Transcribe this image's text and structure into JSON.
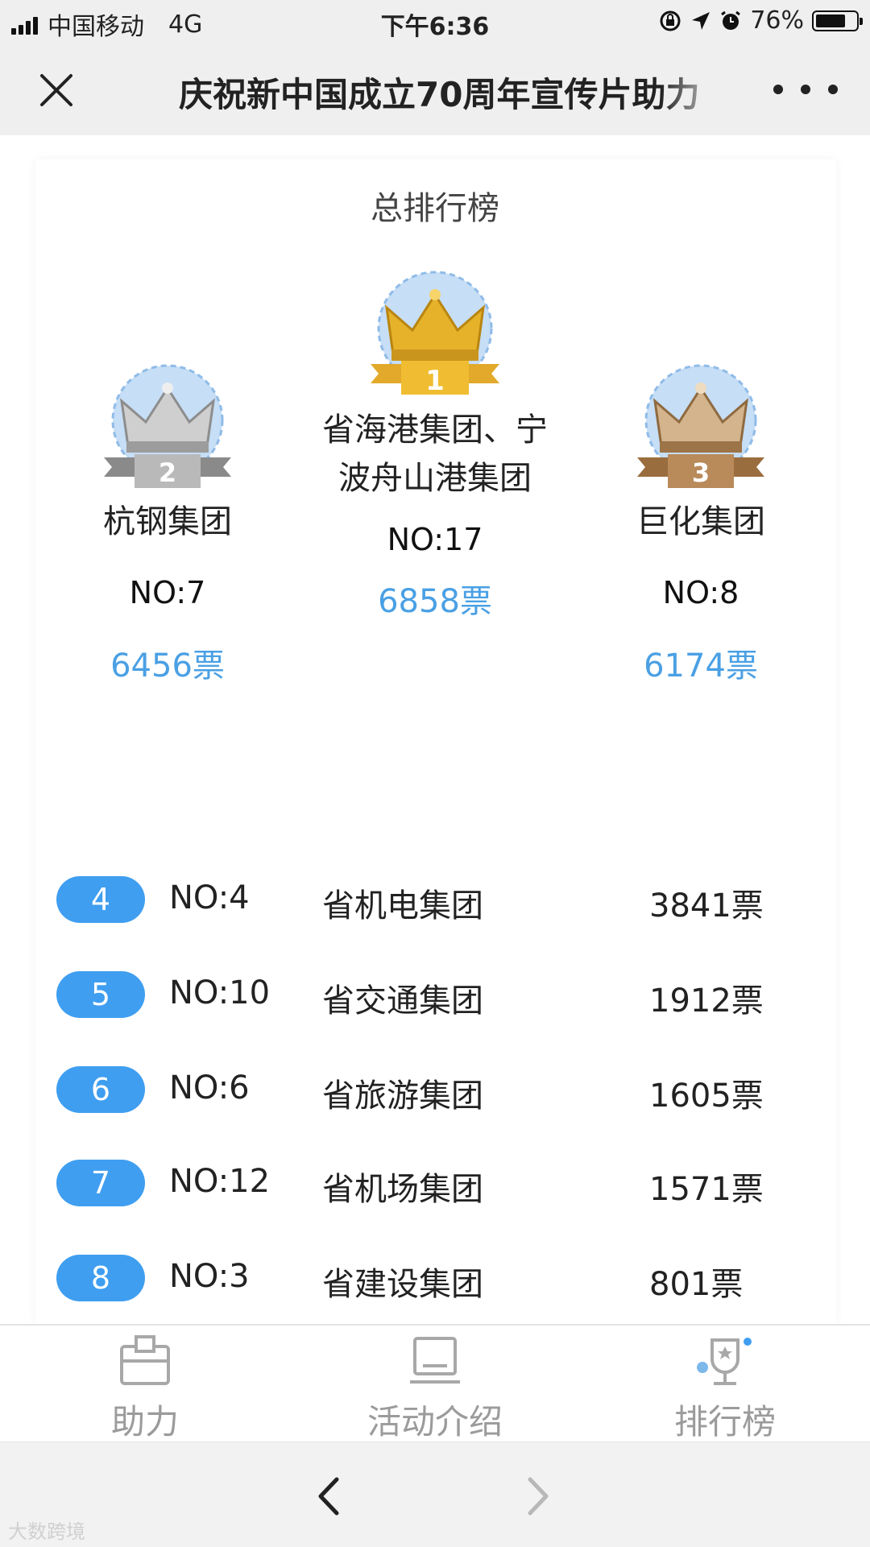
{
  "status_bar": {
    "carrier": "中国移动",
    "network": "4G",
    "time": "下午6:36",
    "battery_percent": "76%",
    "battery_level": 0.76
  },
  "title_bar": {
    "title": "庆祝新中国成立70周年宣传片助力"
  },
  "leaderboard": {
    "title": "总排行榜",
    "first": {
      "rank": "1",
      "name_line1": "省海港集团、宁",
      "name_line2": "波舟山港集团",
      "no": "NO:17",
      "votes": "6858票"
    },
    "second": {
      "rank": "2",
      "name": "杭钢集团",
      "no": "NO:7",
      "votes": "6456票"
    },
    "third": {
      "rank": "3",
      "name": "巨化集团",
      "no": "NO:8",
      "votes": "6174票"
    },
    "rows": [
      {
        "rank": "4",
        "no": "NO:4",
        "name": "省机电集团",
        "votes": "3841票"
      },
      {
        "rank": "5",
        "no": "NO:10",
        "name": "省交通集团",
        "votes": "1912票"
      },
      {
        "rank": "6",
        "no": "NO:6",
        "name": "省旅游集团",
        "votes": "1605票"
      },
      {
        "rank": "7",
        "no": "NO:12",
        "name": "省机场集团",
        "votes": "1571票"
      },
      {
        "rank": "8",
        "no": "NO:3",
        "name": "省建设集团",
        "votes": "801票"
      }
    ]
  },
  "tab_bar": {
    "help": "助力",
    "intro": "活动介绍",
    "ranking": "排行榜"
  },
  "watermark": "大数跨境",
  "colors": {
    "accent": "#3f9ef0",
    "votes": "#4aa0e4",
    "gold": "#e5b22a",
    "silver": "#b9b9b9",
    "bronze": "#b98a5a"
  }
}
